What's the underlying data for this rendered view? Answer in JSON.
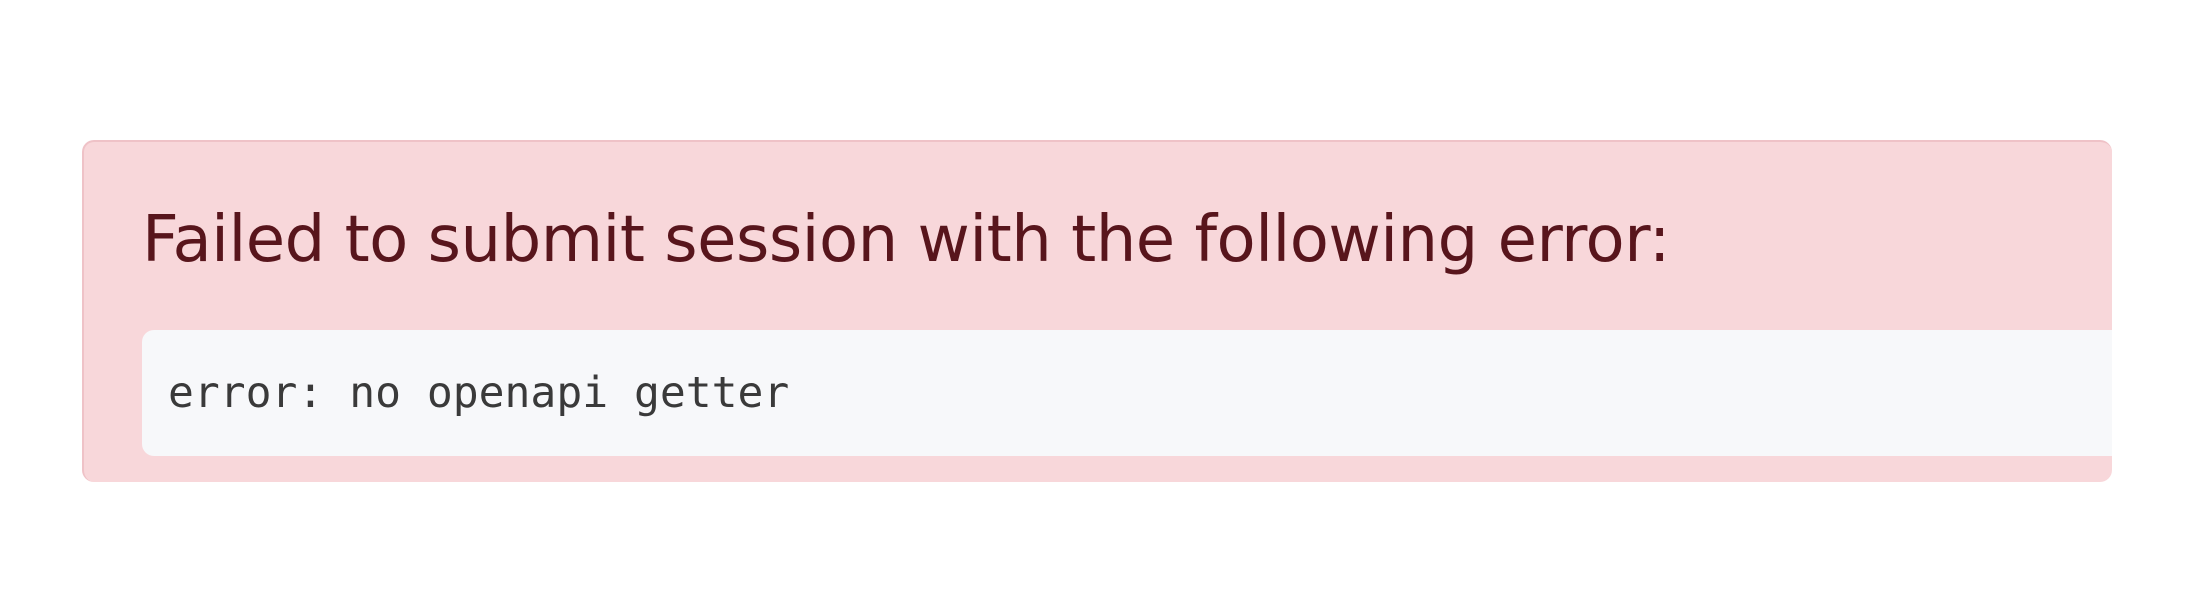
{
  "alert": {
    "heading": "Failed to submit session with the following error:",
    "error_message": "error: no openapi getter",
    "colors": {
      "background": "#f8d7da",
      "border": "#efc2c7",
      "heading_text": "#58151c",
      "code_background": "#f7f8fa",
      "code_text": "#3a3a3a"
    }
  }
}
